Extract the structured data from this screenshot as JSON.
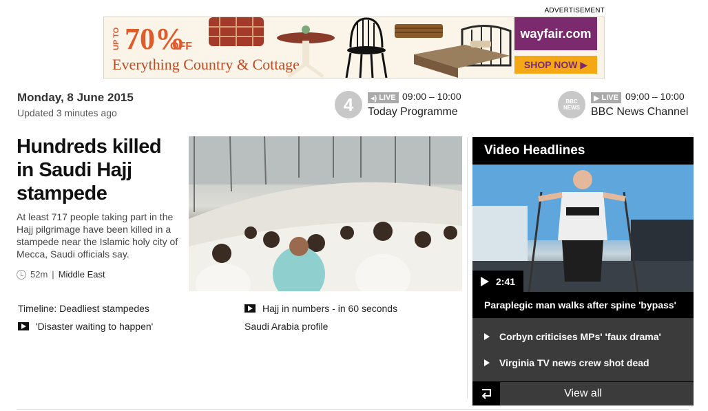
{
  "advert": {
    "label": "ADVERTISEMENT",
    "upto": "UP TO",
    "percent": "70%",
    "off": "OFF",
    "tagline": "Everything Country & Cottage",
    "brand": "wayfair.com",
    "cta": "SHOP NOW ▶"
  },
  "header": {
    "date": "Monday, 8 June 2015",
    "updated": "Updated 3 minutes ago"
  },
  "live": [
    {
      "logo": "4",
      "badge": "LIVE",
      "time": "09:00 – 10:00",
      "title": "Today Programme"
    },
    {
      "logo": "BBC NEWS",
      "badge": "LIVE",
      "time": "09:00 – 10:00",
      "title": "BBC News Channel"
    }
  ],
  "story": {
    "headline": "Hundreds killed in Saudi Hajj stampede",
    "summary": "At least 717 people taking part in the Hajj pilgrimage have been killed in a stampede near the Islamic holy city of Mecca, Saudi officials say.",
    "age": "52m",
    "separator": "|",
    "section": "Middle East",
    "related": [
      {
        "label": "Timeline: Deadliest stampedes",
        "video": false
      },
      {
        "label": "Hajj in numbers - in 60 seconds",
        "video": true
      },
      {
        "label": "'Disaster waiting to happen'",
        "video": true
      },
      {
        "label": "Saudi Arabia profile",
        "video": false
      }
    ]
  },
  "video": {
    "title": "Video Headlines",
    "duration": "2:41",
    "caption": "Paraplegic man walks after spine 'bypass'",
    "items": [
      "Corbyn criticises MPs' 'faux drama'",
      "Virginia TV news crew shot dead"
    ],
    "view_all": "View all"
  },
  "colors": {
    "ad_orange": "#e05a2b",
    "brand_purple": "#7b2a6e",
    "cta_yellow": "#f5a816",
    "panel_dark": "#3b3b3b"
  }
}
